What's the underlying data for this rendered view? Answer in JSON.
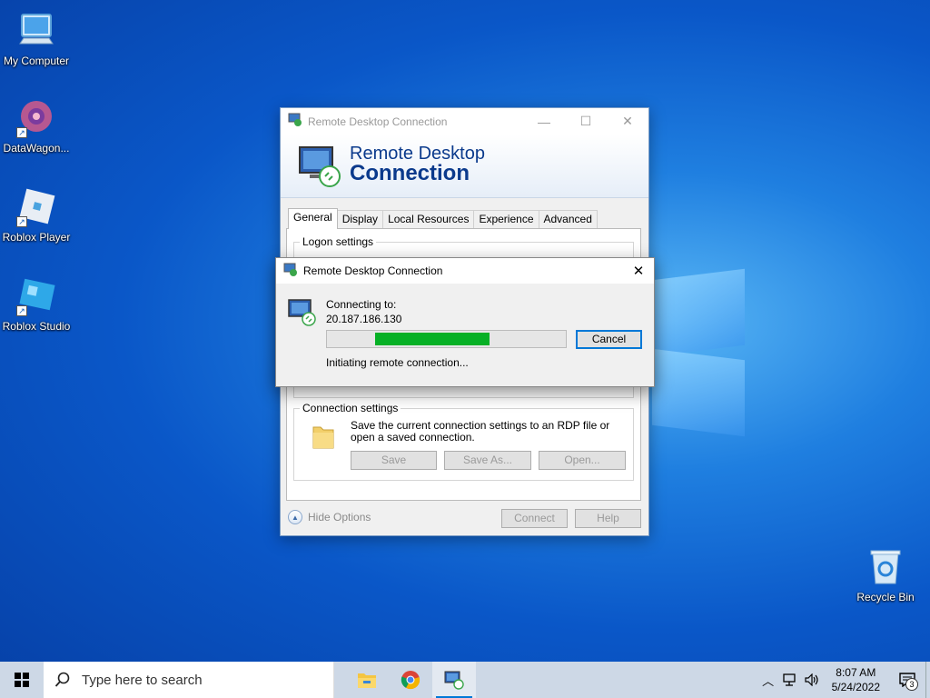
{
  "desktop": {
    "icons": [
      {
        "label": "My Computer"
      },
      {
        "label": "DataWagon..."
      },
      {
        "label": "Roblox Player"
      },
      {
        "label": "Roblox Studio"
      },
      {
        "label": "Recycle Bin"
      }
    ]
  },
  "rdc_window": {
    "title": "Remote Desktop Connection",
    "banner_line1": "Remote Desktop",
    "banner_line2": "Connection",
    "tabs": [
      "General",
      "Display",
      "Local Resources",
      "Experience",
      "Advanced"
    ],
    "logon_settings_label": "Logon settings",
    "connection_settings_label": "Connection settings",
    "connection_settings_text": "Save the current connection settings to an RDP file or open a saved connection.",
    "save_label": "Save",
    "save_as_label": "Save As...",
    "open_label": "Open...",
    "hide_options_label": "Hide Options",
    "connect_label": "Connect",
    "help_label": "Help"
  },
  "connecting_dialog": {
    "title": "Remote Desktop Connection",
    "connecting_to_label": "Connecting to:",
    "address": "20.187.186.130",
    "progress": {
      "start_fraction": 0.2,
      "end_fraction": 0.68
    },
    "cancel_label": "Cancel",
    "status": "Initiating remote connection..."
  },
  "taskbar": {
    "search_placeholder": "Type here to search",
    "time": "8:07 AM",
    "date": "5/24/2022",
    "notification_count": "3"
  },
  "colors": {
    "progress_green": "#06b025",
    "accent_blue": "#0078d7",
    "banner_text": "#0b3a8c"
  }
}
